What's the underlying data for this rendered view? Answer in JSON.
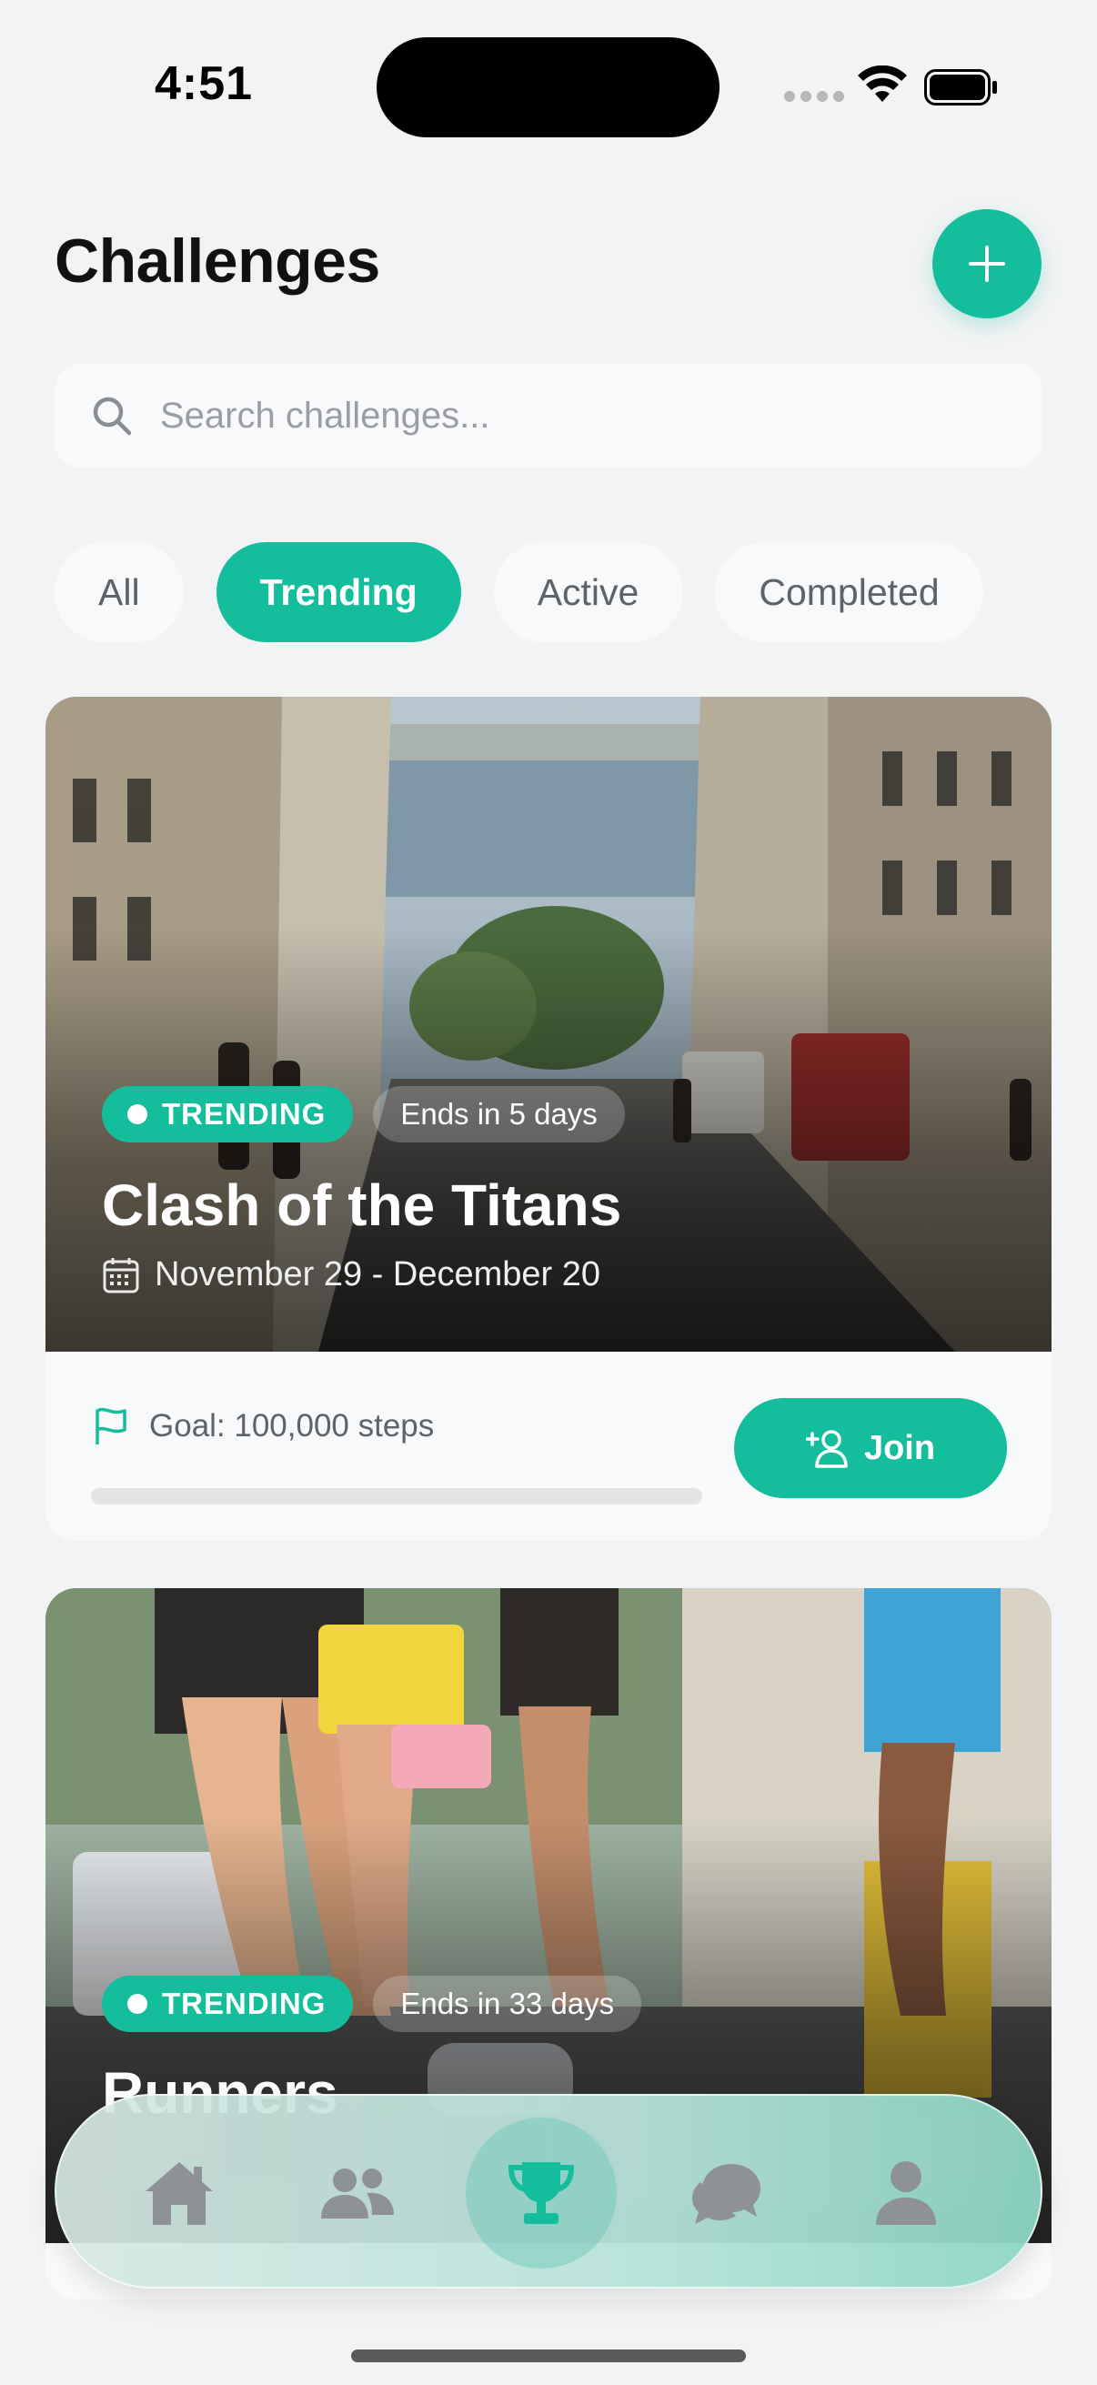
{
  "status_bar": {
    "time": "4:51"
  },
  "header": {
    "title": "Challenges",
    "add_icon": "plus-icon"
  },
  "search": {
    "placeholder": "Search challenges...",
    "value": "",
    "icon": "search-icon"
  },
  "filters": [
    {
      "label": "All",
      "active": false
    },
    {
      "label": "Trending",
      "active": true
    },
    {
      "label": "Active",
      "active": false
    },
    {
      "label": "Completed",
      "active": false
    }
  ],
  "challenges": [
    {
      "badge": "TRENDING",
      "ends": "Ends in 5 days",
      "title": "Clash of the Titans",
      "dates": "November 29 - December 20",
      "goal": "Goal: 100,000 steps",
      "progress": 0,
      "action": "Join"
    },
    {
      "badge": "TRENDING",
      "ends": "Ends in 33 days",
      "title": "Runners"
    }
  ],
  "tabbar": {
    "items": [
      {
        "icon": "home-icon",
        "active": false
      },
      {
        "icon": "users-icon",
        "active": false
      },
      {
        "icon": "trophy-icon",
        "active": true
      },
      {
        "icon": "chat-icon",
        "active": false
      },
      {
        "icon": "profile-icon",
        "active": false
      }
    ]
  },
  "colors": {
    "accent": "#14bd9c",
    "background": "#f2f3f4",
    "inactive_icon": "#8e9294"
  }
}
